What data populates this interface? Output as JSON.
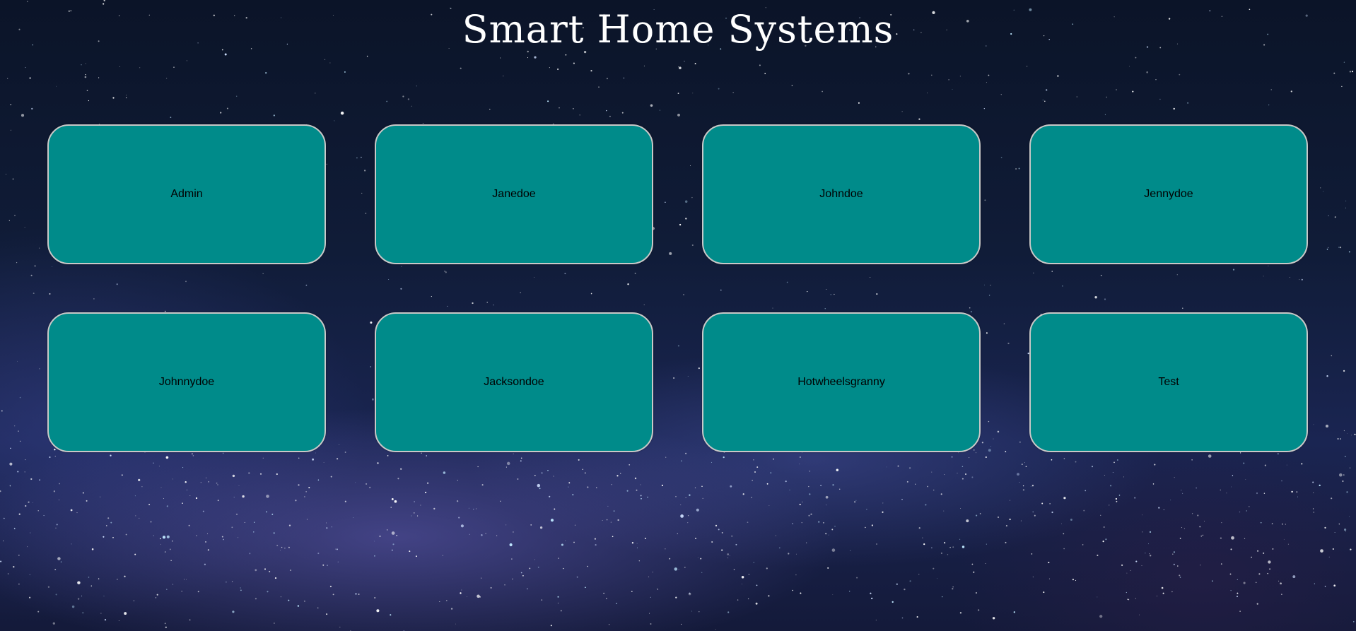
{
  "title": "Smart Home Systems",
  "users": [
    {
      "label": "Admin"
    },
    {
      "label": "Janedoe"
    },
    {
      "label": "Johndoe"
    },
    {
      "label": "Jennydoe"
    },
    {
      "label": "Johnnydoe"
    },
    {
      "label": "Jacksondoe"
    },
    {
      "label": "Hotwheelsgranny"
    },
    {
      "label": "Test"
    }
  ],
  "colors": {
    "card_background": "#008b8a",
    "card_border": "#c8c8c8",
    "title_text": "#ffffff",
    "card_text": "#000000"
  }
}
